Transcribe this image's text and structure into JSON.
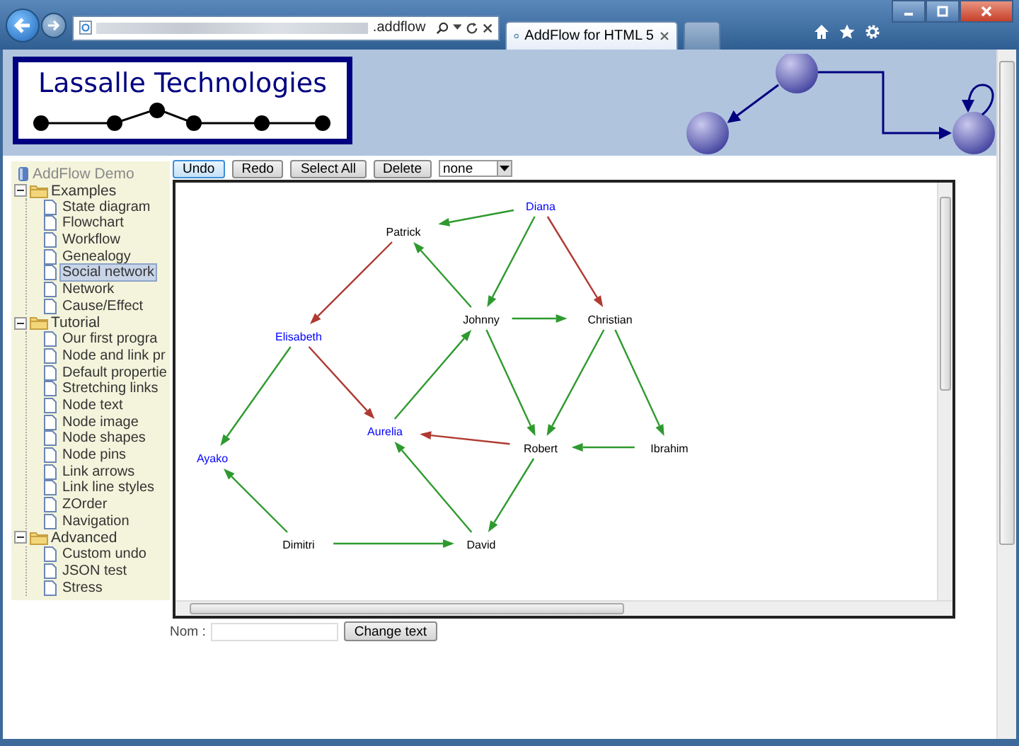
{
  "browser": {
    "address_text": ".addflow",
    "tabs": [
      {
        "label": "AddFlow for HTML 5",
        "selected": true
      }
    ]
  },
  "banner": {
    "logo_text": "Lassalle Technologies"
  },
  "sidebar": {
    "root": "AddFlow Demo",
    "items": [
      {
        "label": "Examples",
        "expanded": true,
        "children": [
          {
            "label": "State diagram",
            "selected": false
          },
          {
            "label": "Flowchart",
            "selected": false
          },
          {
            "label": "Workflow",
            "selected": false
          },
          {
            "label": "Genealogy",
            "selected": false
          },
          {
            "label": "Social network",
            "selected": true
          },
          {
            "label": "Network",
            "selected": false
          },
          {
            "label": "Cause/Effect",
            "selected": false
          }
        ]
      },
      {
        "label": "Tutorial",
        "expanded": true,
        "children": [
          {
            "label": "Our first progra",
            "selected": false
          },
          {
            "label": "Node and link pr",
            "selected": false
          },
          {
            "label": "Default propertie",
            "selected": false
          },
          {
            "label": "Stretching links",
            "selected": false
          },
          {
            "label": "Node text",
            "selected": false
          },
          {
            "label": "Node image",
            "selected": false
          },
          {
            "label": "Node shapes",
            "selected": false
          },
          {
            "label": "Node pins",
            "selected": false
          },
          {
            "label": "Link arrows",
            "selected": false
          },
          {
            "label": "Link line styles",
            "selected": false
          },
          {
            "label": "ZOrder",
            "selected": false
          },
          {
            "label": "Navigation",
            "selected": false
          }
        ]
      },
      {
        "label": "Advanced",
        "expanded": true,
        "children": [
          {
            "label": "Custom undo",
            "selected": false
          },
          {
            "label": "JSON test",
            "selected": false
          },
          {
            "label": "Stress",
            "selected": false
          }
        ]
      }
    ]
  },
  "toolbar": {
    "buttons": [
      {
        "label": "Undo",
        "focused": true
      },
      {
        "label": "Redo",
        "focused": false
      },
      {
        "label": "Select All",
        "focused": false
      },
      {
        "label": "Delete",
        "focused": false
      }
    ],
    "select_value": "none"
  },
  "graph": {
    "nodes": [
      {
        "label": "Diana",
        "color": "#0000ff"
      },
      {
        "label": "Patrick",
        "color": "#000000"
      },
      {
        "label": "Johnny",
        "color": "#000000"
      },
      {
        "label": "Christian",
        "color": "#000000"
      },
      {
        "label": "Elisabeth",
        "color": "#0000ff"
      },
      {
        "label": "Aurelia",
        "color": "#0000ff"
      },
      {
        "label": "Robert",
        "color": "#000000"
      },
      {
        "label": "Ibrahim",
        "color": "#000000"
      },
      {
        "label": "Ayako",
        "color": "#0000ff"
      },
      {
        "label": "Dimitri",
        "color": "#000000"
      },
      {
        "label": "David",
        "color": "#000000"
      }
    ],
    "links": [
      {
        "color": "#2e9a2e"
      },
      {
        "color": "#2e9a2e"
      },
      {
        "color": "#b03a32"
      },
      {
        "color": "#b03a32"
      },
      {
        "color": "#2e9a2e"
      },
      {
        "color": "#2e9a2e"
      },
      {
        "color": "#2e9a2e"
      },
      {
        "color": "#2e9a2e"
      },
      {
        "color": "#2e9a2e"
      },
      {
        "color": "#b03a32"
      },
      {
        "color": "#2e9a2e"
      },
      {
        "color": "#2e9a2e"
      },
      {
        "color": "#b03a32"
      },
      {
        "color": "#2e9a2e"
      },
      {
        "color": "#2e9a2e"
      },
      {
        "color": "#2e9a2e"
      },
      {
        "color": "#2e9a2e"
      },
      {
        "color": "#2e9a2e"
      }
    ]
  },
  "form": {
    "label": "Nom :",
    "button": "Change text"
  }
}
